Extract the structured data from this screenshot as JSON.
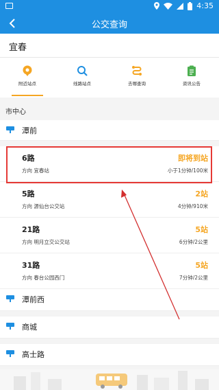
{
  "status_bar": {
    "time": "4:35"
  },
  "app_bar": {
    "title": "公交查询"
  },
  "city": "宜春",
  "tabs": [
    {
      "label": "附近站点",
      "icon": "location-pin-icon",
      "active": true,
      "color": "#F5A623"
    },
    {
      "label": "线路站点",
      "icon": "search-icon",
      "active": false,
      "color": "#1E8FE1"
    },
    {
      "label": "去哪查询",
      "icon": "route-icon",
      "active": false,
      "color": "#F5A623"
    },
    {
      "label": "资讯公告",
      "icon": "clipboard-icon",
      "active": false,
      "color": "#4CAF50"
    }
  ],
  "section_title": "市中心",
  "stops": [
    {
      "name": "潭前"
    },
    {
      "name": "潭前西"
    },
    {
      "name": "商城"
    },
    {
      "name": "高士路"
    }
  ],
  "routes": [
    {
      "name": "6路",
      "direction": "方向 宜春站",
      "eta": "即将到站",
      "distance": "小于1分钟/100米"
    },
    {
      "name": "5路",
      "direction": "方向 源仙台公交站",
      "eta": "2站",
      "distance": "4分钟/910米"
    },
    {
      "name": "21路",
      "direction": "方向 明月立交公交站",
      "eta": "5站",
      "distance": "6分钟/2公里"
    },
    {
      "name": "31路",
      "direction": "方向 春台公园西门",
      "eta": "5站",
      "distance": "7分钟/2公里"
    }
  ],
  "colors": {
    "primary": "#1E8FE1",
    "accent": "#F5A623",
    "highlight": "#E53935"
  }
}
